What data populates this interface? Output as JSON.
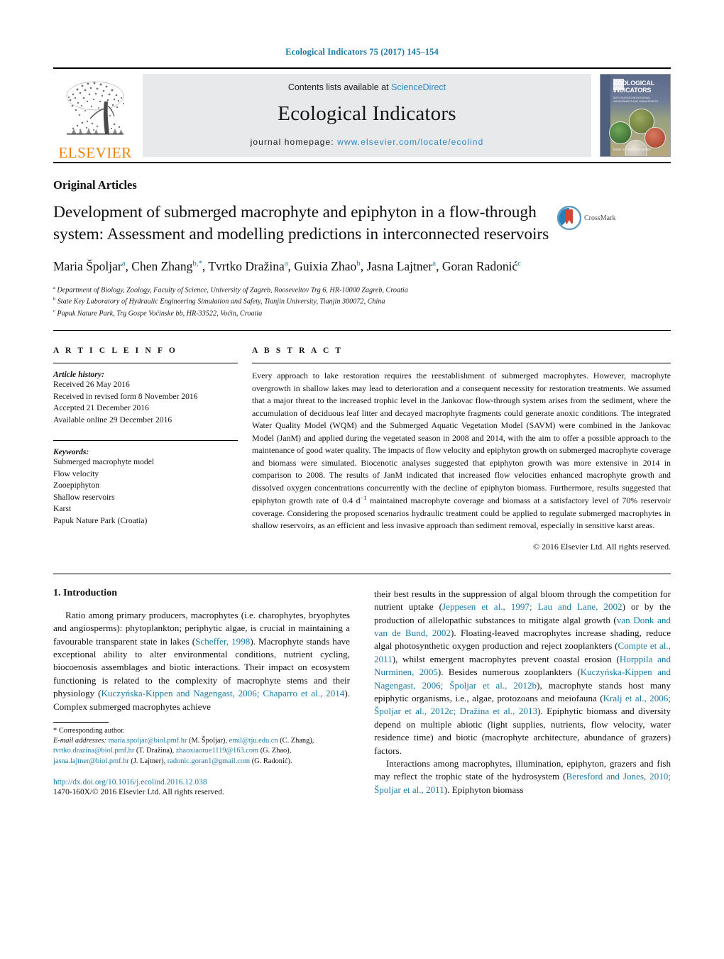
{
  "running_head": "Ecological Indicators 75 (2017) 145–154",
  "masthead": {
    "publisher_name": "ELSEVIER",
    "contents_prefix": "Contents lists available at ",
    "contents_link": "ScienceDirect",
    "journal_name": "Ecological Indicators",
    "homepage_prefix": "journal homepage: ",
    "homepage_url": "www.elsevier.com/locate/ecolind",
    "cover": {
      "title": "ECOLOGICAL INDICATORS",
      "subtitle": "INTEGRATING MONITORING, ASSESSMENT AND MANAGEMENT",
      "footer": "Editor-in-Chief\nFelix Müller"
    }
  },
  "article": {
    "type": "Original Articles",
    "title": "Development of submerged macrophyte and epiphyton in a flow-through system: Assessment and modelling predictions in interconnected reservoirs",
    "crossmark_label": "CrossMark",
    "authors": [
      {
        "name": "Maria Špoljar",
        "sup": "a",
        "sep": ", "
      },
      {
        "name": "Chen Zhang",
        "sup": "b,*",
        "sep": ", "
      },
      {
        "name": "Tvrtko Dražina",
        "sup": "a",
        "sep": ", "
      },
      {
        "name": "Guixia Zhao",
        "sup": "b",
        "sep": ", "
      },
      {
        "name": "Jasna Lajtner",
        "sup": "a",
        "sep": ", "
      },
      {
        "name": "Goran Radonić",
        "sup": "c",
        "sep": ""
      }
    ],
    "affiliations": [
      {
        "sup": "a",
        "text": "Department of Biology, Zoology, Faculty of Science, University of Zagreb, Rooseveltov Trg 6, HR-10000 Zagreb, Croatia"
      },
      {
        "sup": "b",
        "text": "State Key Laboratory of Hydraulic Engineering Simulation and Safety, Tianjin University, Tianjin 300072, China"
      },
      {
        "sup": "c",
        "text": "Papuk Nature Park, Trg Gospe Voćinske bb, HR-33522, Voćin, Croatia"
      }
    ]
  },
  "article_info": {
    "heading": "A R T I C L E    I N F O",
    "history_label": "Article history:",
    "history": [
      "Received 26 May 2016",
      "Received in revised form 8 November 2016",
      "Accepted 21  December 2016",
      "Available online 29 December 2016"
    ],
    "keywords_label": "Keywords:",
    "keywords": [
      "Submerged macrophyte model",
      "Flow velocity",
      "Zooepiphyton",
      "Shallow reservoirs",
      "Karst",
      "Papuk Nature Park (Croatia)"
    ]
  },
  "abstract": {
    "heading": "A B S T R A C T",
    "text": "Every approach to lake restoration requires the reestablishment of submerged macrophytes. However, macrophyte overgrowth in shallow lakes may lead to deterioration and a consequent necessity for restoration treatments. We assumed that a major threat to the increased trophic level in the Jankovac flow-through system arises from the sediment, where the accumulation of deciduous leaf litter and decayed macrophyte fragments could generate anoxic conditions. The integrated Water Quality Model (WQM) and the Submerged Aquatic Vegetation Model (SAVM) were combined in the Jankovac Model (JanM) and applied during the vegetated season in 2008 and 2014, with the aim to offer a possible approach to the maintenance of good water quality. The impacts of flow velocity and epiphyton growth on submerged macrophyte coverage and biomass were simulated. Biocenotic analyses suggested that epiphyton growth was more extensive in 2014 in comparison to 2008. The results of JanM indicated that increased flow velocities enhanced macrophyte growth and dissolved oxygen concentrations concurrently with the decline of epiphyton biomass. Furthermore, results suggested that epiphyton growth rate of 0.4 d−1 maintained macrophyte coverage and biomass at a satisfactory level of 70% reservoir coverage. Considering the proposed scenarios hydraulic treatment could be applied to regulate submerged macrophytes in shallow reservoirs, as an efficient and less invasive approach than sediment removal, especially in sensitive karst areas.",
    "copyright": "© 2016 Elsevier Ltd. All rights reserved."
  },
  "introduction": {
    "number_title": "1.  Introduction",
    "left_paragraph_plain": "Ratio among primary producers, macrophytes (i.e. charophytes, bryophytes and angiosperms): phytoplankton; periphytic algae, is crucial in maintaining a favourable transparent state in lakes (Scheffer, 1998). Macrophyte stands have exceptional ability to alter environmental conditions, nutrient cycling, biocoenosis assemblages and biotic interactions. Their impact on ecosystem functioning is related to the complexity of macrophyte stems and their physiology (Kuczyńska-Kippen and Nagengast, 2006; Chaparro et al., 2014). Complex submerged macrophytes achieve",
    "right_paragraph_1_plain": "their best results in the suppression of algal bloom through the competition for nutrient uptake (Jeppesen et al., 1997; Lau and Lane, 2002) or by the production of allelopathic substances to mitigate algal growth (van Donk and van de Bund, 2002). Floating-leaved macrophytes increase shading, reduce algal photosynthetic oxygen production and reject zooplankters (Compte et al., 2011), whilst emergent macrophytes prevent coastal erosion (Horppila and Nurminen, 2005). Besides numerous zooplankters (Kuczyńska-Kippen and Nagengast, 2006; Špoljar et al., 2012b), macrophyte stands host many epiphytic organisms, i.e., algae, protozoans and meiofauna (Kralj et al., 2006; Špoljar et al., 2012c; Dražina et al., 2013). Epiphytic biomass and diversity depend on multiple abiotic (light supplies, nutrients, flow velocity, water residence time) and biotic (macrophyte architecture, abundance of grazers) factors.",
    "right_paragraph_2_plain": "Interactions among macrophytes, illumination, epiphyton, grazers and fish may reflect the trophic state of the hydrosystem (Beresford and Jones, 2010; Špoljar et al., 2011). Epiphyton biomass"
  },
  "footnotes": {
    "corresponding_marker": "*",
    "corresponding_text": "Corresponding author.",
    "email_label": "E-mail addresses:",
    "emails": [
      {
        "address": "maria.spoljar@biol.pmf.hr",
        "owner": "(M. Špoljar)"
      },
      {
        "address": "emil@tju.edu.cn",
        "owner": "(C. Zhang)"
      },
      {
        "address": "tvrtko.drazina@biol.pmf.hr",
        "owner": "(T. Dražina)"
      },
      {
        "address": "zhaoxiaorue1119@163.com",
        "owner": "(G. Zhao)"
      },
      {
        "address": "jasna.lajtner@biol.pmf.hr",
        "owner": "(J. Lajtner)"
      },
      {
        "address": "radonic.goran1@gmail.com",
        "owner": "(G. Radonić)."
      }
    ],
    "doi": "http://dx.doi.org/10.1016/j.ecolind.2016.12.038",
    "issn": "1470-160X/© 2016 Elsevier Ltd. All rights reserved."
  },
  "colors": {
    "link": "#1a7aa5",
    "sciencedirect": "#2a88c4",
    "elsevier_orange": "#f08000",
    "band_gray": "#e8e9ea"
  }
}
